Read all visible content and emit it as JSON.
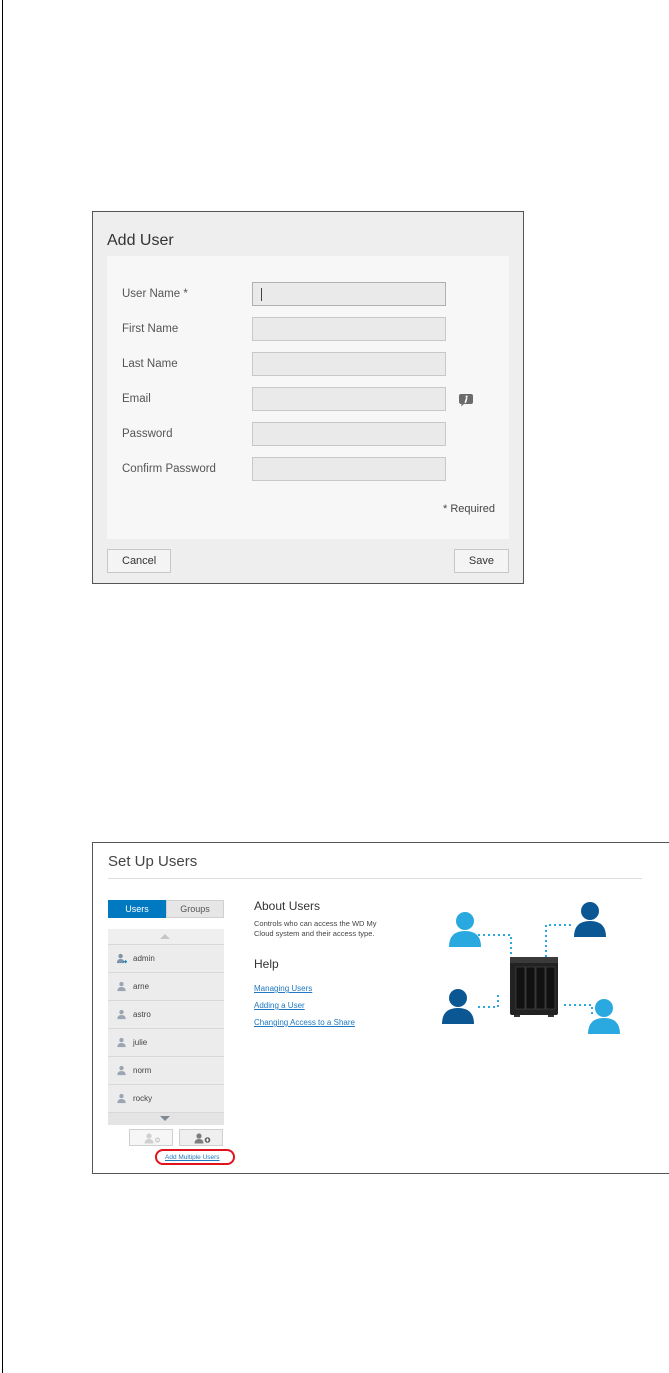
{
  "add_user_dialog": {
    "title": "Add User",
    "fields": [
      {
        "label": "User Name *",
        "value": ""
      },
      {
        "label": "First Name",
        "value": ""
      },
      {
        "label": "Last Name",
        "value": ""
      },
      {
        "label": "Email",
        "value": ""
      },
      {
        "label": "Password",
        "value": ""
      },
      {
        "label": "Confirm Password",
        "value": ""
      }
    ],
    "required_note": "* Required",
    "cancel_label": "Cancel",
    "save_label": "Save"
  },
  "setup_users": {
    "title": "Set Up Users",
    "tabs": {
      "users": "Users",
      "groups": "Groups"
    },
    "users": [
      "admin",
      "arne",
      "astro",
      "julie",
      "norm",
      "rocky"
    ],
    "add_multiple_label": "Add Multiple Users",
    "about_heading": "About Users",
    "about_text": "Controls who can access the WD My Cloud system and their access type.",
    "help_heading": "Help",
    "help_links": [
      "Managing Users",
      "Adding a User",
      "Changing Access to a Share"
    ]
  },
  "colors": {
    "accent": "#0079c1",
    "link": "#1f78c1",
    "highlight": "#e0121b"
  }
}
